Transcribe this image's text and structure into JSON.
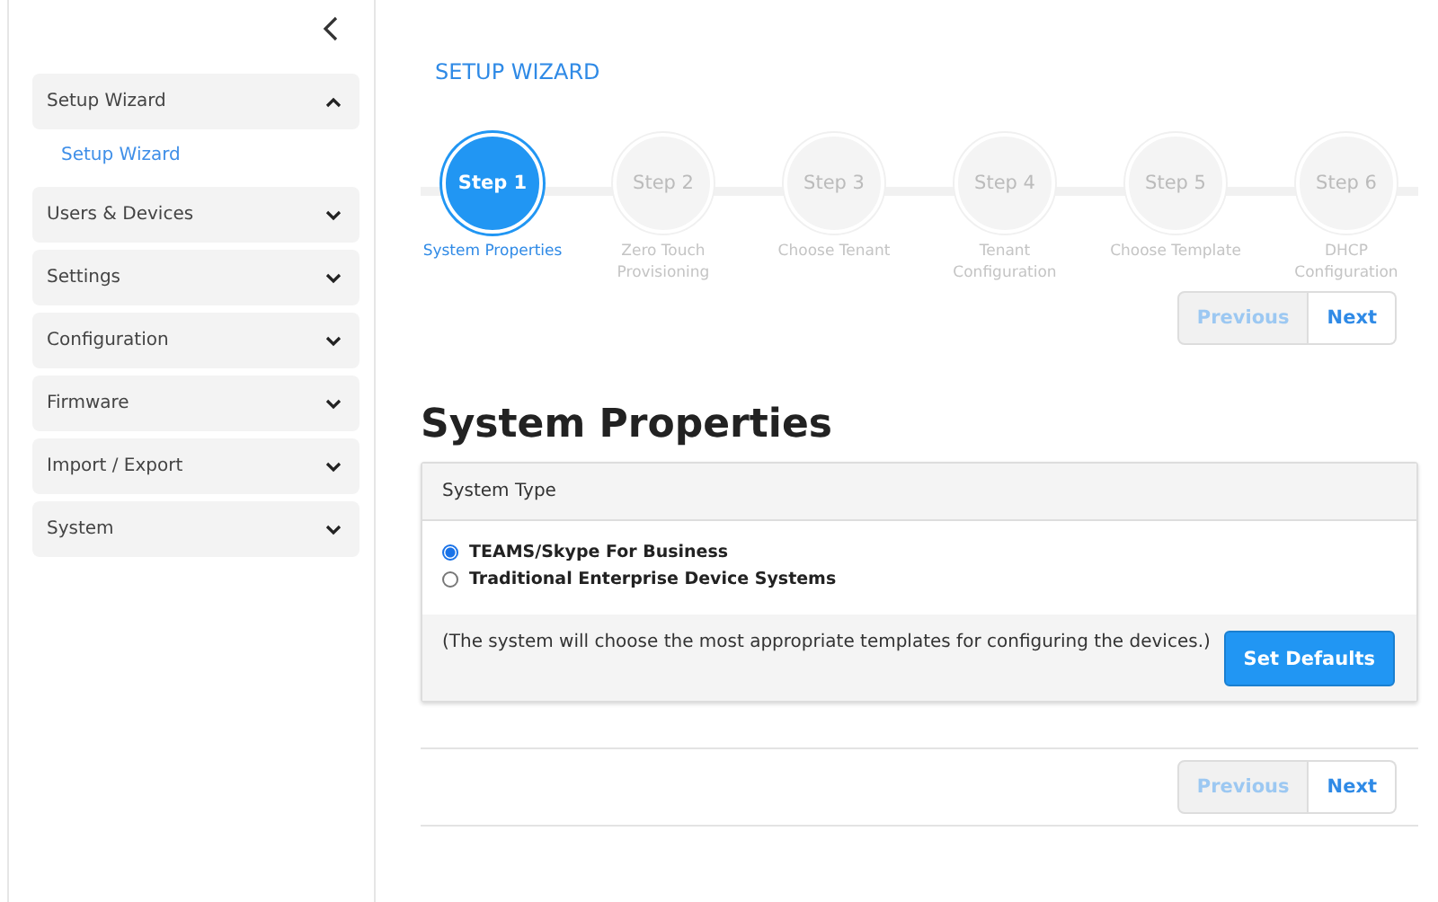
{
  "sidebar": {
    "items": [
      {
        "label": "Setup Wizard",
        "expanded": true,
        "children": [
          {
            "label": "Setup Wizard",
            "selected": true
          }
        ]
      },
      {
        "label": "Users & Devices",
        "expanded": false
      },
      {
        "label": "Settings",
        "expanded": false
      },
      {
        "label": "Configuration",
        "expanded": false
      },
      {
        "label": "Firmware",
        "expanded": false
      },
      {
        "label": "Import / Export",
        "expanded": false
      },
      {
        "label": "System",
        "expanded": false
      }
    ]
  },
  "page_title": "SETUP WIZARD",
  "steps": [
    {
      "label": "Step 1",
      "caption": "System Properties",
      "selected": true
    },
    {
      "label": "Step 2",
      "caption": "Zero Touch Provisioning",
      "selected": false
    },
    {
      "label": "Step 3",
      "caption": "Choose Tenant",
      "selected": false
    },
    {
      "label": "Step 4",
      "caption": "Tenant Configuration",
      "selected": false
    },
    {
      "label": "Step 5",
      "caption": "Choose Template",
      "selected": false
    },
    {
      "label": "Step 6",
      "caption": "DHCP Configuration",
      "selected": false
    }
  ],
  "top_nav": [
    {
      "label": "Previous",
      "disabled": true
    },
    {
      "label": "Next",
      "disabled": false
    }
  ],
  "heading": "System Properties",
  "card": {
    "header": "System Type",
    "options": [
      {
        "label": "TEAMS/Skype For Business",
        "selected": true
      },
      {
        "label": "Traditional Enterprise Device Systems",
        "selected": false
      }
    ],
    "note": "(The system will choose the most appropriate templates for configuring the devices.)",
    "button": "Set Defaults"
  },
  "bottom_nav": [
    {
      "label": "Previous",
      "disabled": true
    },
    {
      "label": "Next",
      "disabled": false
    }
  ]
}
